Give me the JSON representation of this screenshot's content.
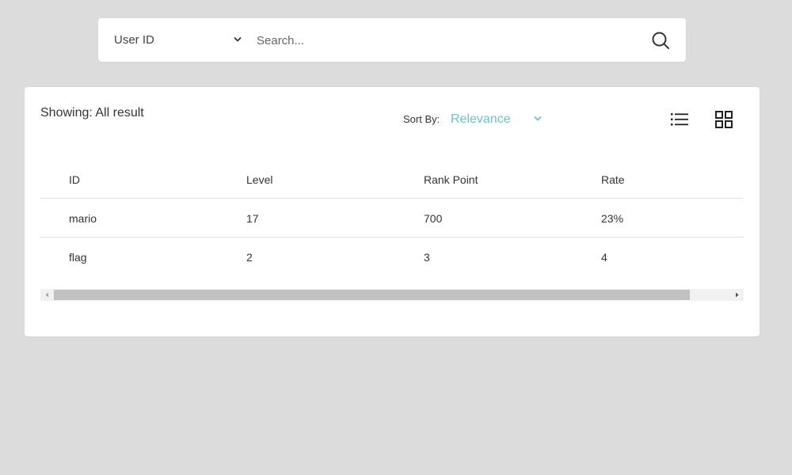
{
  "search": {
    "filter_label": "User ID",
    "placeholder": "Search...",
    "value": ""
  },
  "results": {
    "showing_label": "Showing: All result",
    "sort_label": "Sort By:",
    "sort_value": "Relevance",
    "columns": [
      "ID",
      "Level",
      "Rank Point",
      "Rate"
    ],
    "rows": [
      [
        "mario",
        "17",
        "700",
        "23%"
      ],
      [
        "flag",
        "2",
        "3",
        "4"
      ]
    ]
  },
  "icons": {
    "filter_chevron": "chevron-down-icon",
    "search": "search-icon",
    "sort_chevron": "chevron-down-icon",
    "list_view": "list-view-icon",
    "grid_view": "grid-view-icon"
  },
  "colors": {
    "background": "#dcdcdc",
    "card": "#ffffff",
    "accent": "#6ec1c8",
    "text": "#333333",
    "scroll_thumb": "#c1c1c1"
  }
}
